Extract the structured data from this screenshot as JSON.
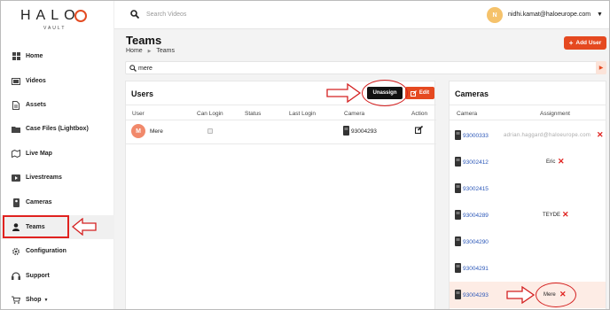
{
  "app": {
    "brand": "HALO",
    "brand_sub": "VAULT"
  },
  "topbar": {
    "search_placeholder": "Search Videos",
    "avatar_initial": "N",
    "user_email": "nidhi.kamat@haloeurope.com"
  },
  "sidebar": {
    "items": [
      {
        "label": "Home",
        "icon": "home-icon"
      },
      {
        "label": "Videos",
        "icon": "video-icon"
      },
      {
        "label": "Assets",
        "icon": "file-icon"
      },
      {
        "label": "Case Files (Lightbox)",
        "icon": "folder-icon"
      },
      {
        "label": "Live Map",
        "icon": "map-icon"
      },
      {
        "label": "Livestreams",
        "icon": "livestream-icon"
      },
      {
        "label": "Cameras",
        "icon": "camera-icon"
      },
      {
        "label": "Teams",
        "icon": "user-icon"
      },
      {
        "label": "Configuration",
        "icon": "gear-icon"
      },
      {
        "label": "Support",
        "icon": "headset-icon"
      },
      {
        "label": "Shop",
        "icon": "cart-icon"
      }
    ],
    "active": "Teams"
  },
  "page": {
    "title": "Teams",
    "breadcrumb": [
      "Home",
      "Teams"
    ],
    "add_button": "Add User",
    "filter_value": "mere"
  },
  "users": {
    "title": "Users",
    "unassign_label": "Unassign",
    "edit_label": "Edit",
    "columns": [
      "User",
      "Can Login",
      "Status",
      "Last Login",
      "Camera",
      "Action"
    ],
    "rows": [
      {
        "initial": "M",
        "name": "Mere",
        "camera": "93004293"
      }
    ]
  },
  "cameras": {
    "title": "Cameras",
    "columns": [
      "Camera",
      "Assignment"
    ],
    "rows": [
      {
        "id": "93000333",
        "assignment": "adrian.haggard@haloeurope.com"
      },
      {
        "id": "93002412",
        "assignment": "Eric"
      },
      {
        "id": "93002415",
        "assignment": ""
      },
      {
        "id": "93004289",
        "assignment": "TEYDE"
      },
      {
        "id": "93004290",
        "assignment": ""
      },
      {
        "id": "93004291",
        "assignment": ""
      },
      {
        "id": "93004293",
        "assignment": "Mere"
      }
    ]
  },
  "colors": {
    "accent": "#e54920",
    "annotation": "#d42020",
    "link": "#2b57b8"
  }
}
